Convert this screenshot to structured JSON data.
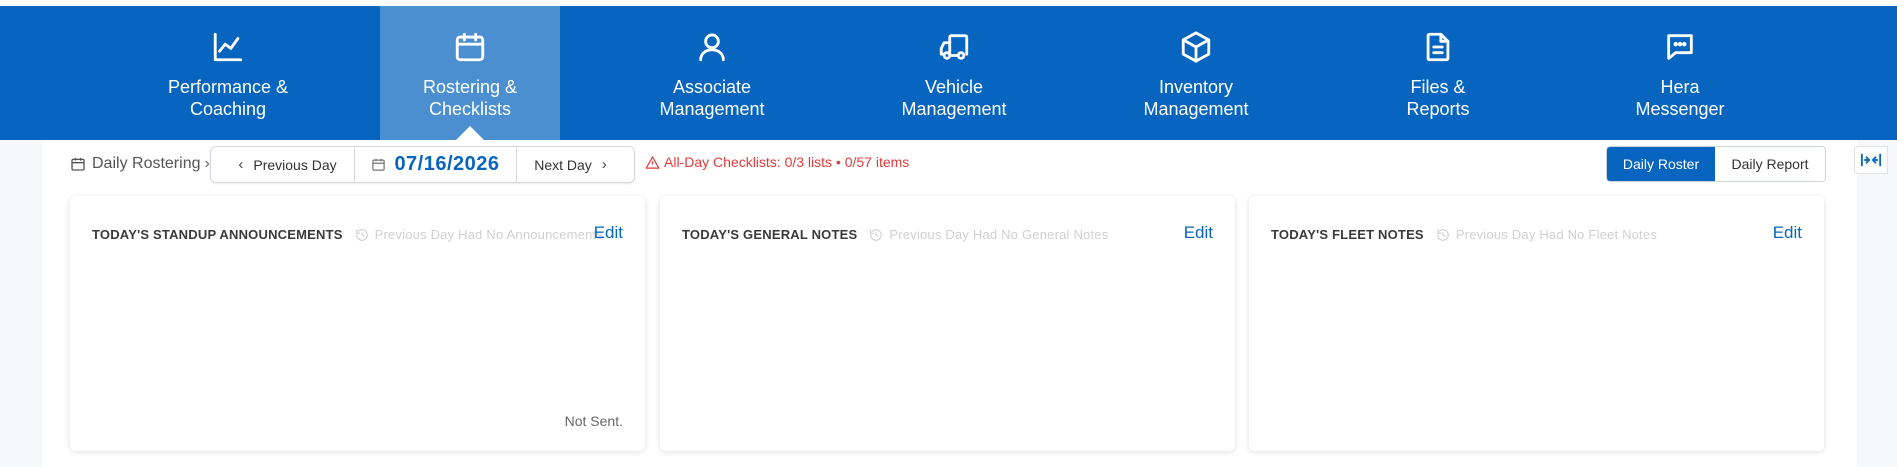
{
  "nav": {
    "items": [
      {
        "label": "Performance &\nCoaching",
        "icon": "chart-line-icon"
      },
      {
        "label": "Rostering &\nChecklists",
        "icon": "calendar-icon"
      },
      {
        "label": "Associate\nManagement",
        "icon": "user-icon"
      },
      {
        "label": "Vehicle\nManagement",
        "icon": "truck-icon"
      },
      {
        "label": "Inventory\nManagement",
        "icon": "box-icon"
      },
      {
        "label": "Files &\nReports",
        "icon": "file-icon"
      },
      {
        "label": "Hera\nMessenger",
        "icon": "message-icon"
      }
    ],
    "active_index": 1
  },
  "breadcrumb": {
    "label": "Daily Rostering"
  },
  "date_nav": {
    "prev_label": "Previous Day",
    "date": "07/16/2026",
    "next_label": "Next Day"
  },
  "warning": {
    "text": "All-Day Checklists: 0/3 lists • 0/57 items"
  },
  "view_toggle": {
    "active": "Daily Roster",
    "inactive": "Daily Report"
  },
  "cards": [
    {
      "title": "TODAY'S STANDUP ANNOUNCEMENTS",
      "hint": "Previous Day Had No Announcements",
      "edit": "Edit",
      "status": "Not Sent."
    },
    {
      "title": "TODAY'S GENERAL NOTES",
      "hint": "Previous Day Had No General Notes",
      "edit": "Edit"
    },
    {
      "title": "TODAY'S FLEET NOTES",
      "hint": "Previous Day Had No Fleet Notes",
      "edit": "Edit"
    }
  ],
  "colors": {
    "brand": "#0765bf",
    "active_nav": "#4b8fd0",
    "warning": "#e23b3b"
  }
}
